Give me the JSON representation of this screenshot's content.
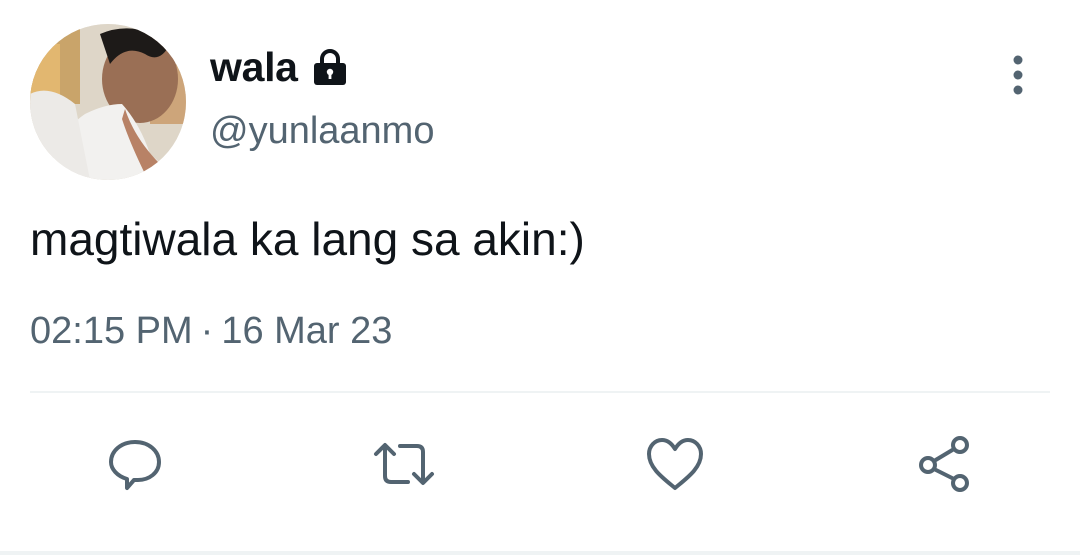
{
  "tweet": {
    "display_name": "wala",
    "handle": "@yunlaanmo",
    "text": "magtiwala ka lang sa akin:)",
    "time": "02:15 PM",
    "separator": "·",
    "date": "16 Mar 23"
  },
  "icons": {
    "lock": "lock-icon",
    "more": "more-vertical-icon",
    "reply": "reply-icon",
    "retweet": "retweet-icon",
    "like": "heart-icon",
    "share": "share-icon"
  },
  "colors": {
    "text_primary": "#0f1419",
    "text_secondary": "#536471",
    "icon": "#536471",
    "divider": "#eff3f4"
  }
}
